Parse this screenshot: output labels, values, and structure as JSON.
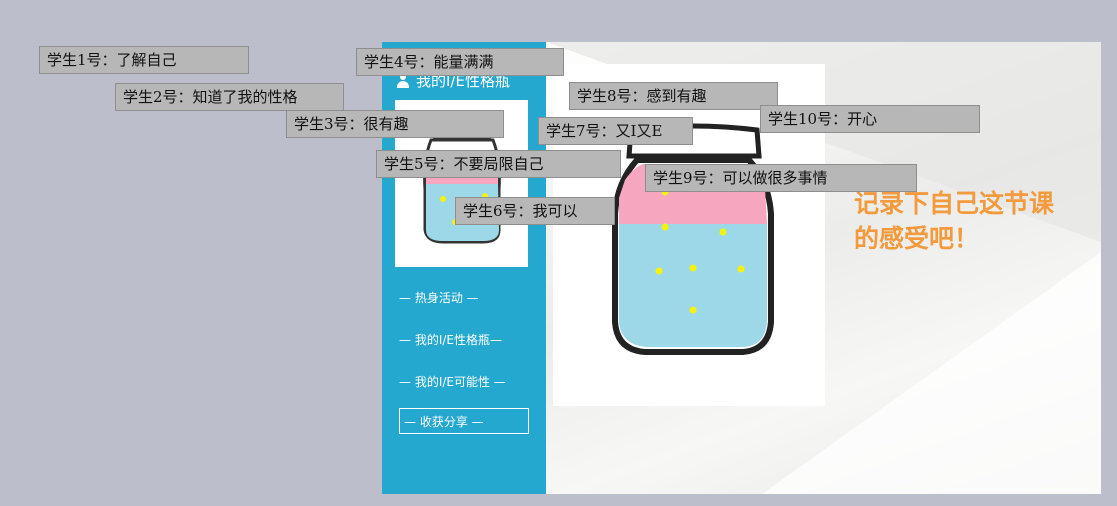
{
  "sidebar": {
    "title": "我的I/E性格瓶",
    "nav": [
      {
        "label": "— 热身活动 —"
      },
      {
        "label": "— 我的I/E性格瓶—"
      },
      {
        "label": "— 我的I/E可能性 —"
      },
      {
        "label": "— 收获分享 —"
      }
    ],
    "active_index": 3
  },
  "main": {
    "prompt_line1": "记录下自己这节课",
    "prompt_line2": "的感受吧！"
  },
  "comments": [
    {
      "text": "学生1号：了解自己"
    },
    {
      "text": "学生2号：知道了我的性格"
    },
    {
      "text": "学生3号：很有趣"
    },
    {
      "text": "学生4号：能量满满"
    },
    {
      "text": "学生5号：不要局限自己"
    },
    {
      "text": "学生6号：我可以"
    },
    {
      "text": "学生7号：又I又E"
    },
    {
      "text": "学生8号：感到有趣"
    },
    {
      "text": "学生9号：可以做很多事情"
    },
    {
      "text": "学生10号：开心"
    }
  ],
  "colors": {
    "sidebar": "#24a8cf",
    "prompt": "#f39a3c",
    "jar_pink": "#f7a6c0",
    "jar_blue": "#9dd8e8",
    "star": "#f6f20a",
    "comment_bg": "#b7b7b7"
  },
  "icons": [
    "user-icon",
    "star-icon"
  ]
}
